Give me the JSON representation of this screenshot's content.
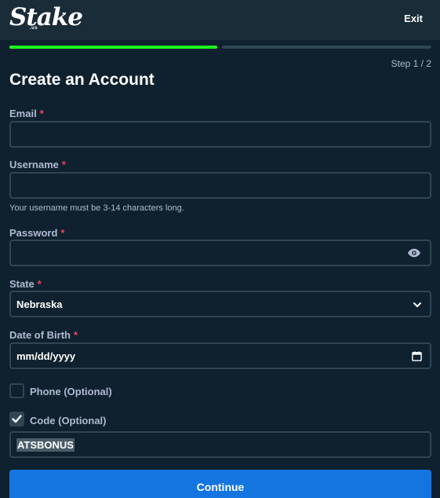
{
  "header": {
    "logo_text": "Stake",
    "logo_suffix": ".us",
    "exit_label": "Exit"
  },
  "progress": {
    "current_step": 1,
    "total_steps": 2,
    "fraction": 0.5
  },
  "step_label": "Step 1 / 2",
  "title": "Create an Account",
  "required_marker": "*",
  "email": {
    "label": "Email",
    "value": ""
  },
  "username": {
    "label": "Username",
    "value": "",
    "hint": "Your username must be 3-14 characters long."
  },
  "password": {
    "label": "Password",
    "value": "",
    "icon": "eye-icon"
  },
  "state": {
    "label": "State",
    "value": "Nebraska",
    "icon": "chevron-down-icon"
  },
  "dob": {
    "label": "Date of Birth",
    "placeholder": "mm/dd/yyyy",
    "icon": "calendar-icon"
  },
  "phone": {
    "label": "Phone (Optional)",
    "checked": false
  },
  "code": {
    "label": "Code (Optional)",
    "checked": true,
    "value": "ATSBONUS"
  },
  "continue_label": "Continue",
  "colors": {
    "background": "#0f212e",
    "header": "#1a2c38",
    "accent_green": "#1fff20",
    "primary_button": "#1475e1",
    "required": "#ed4163"
  }
}
